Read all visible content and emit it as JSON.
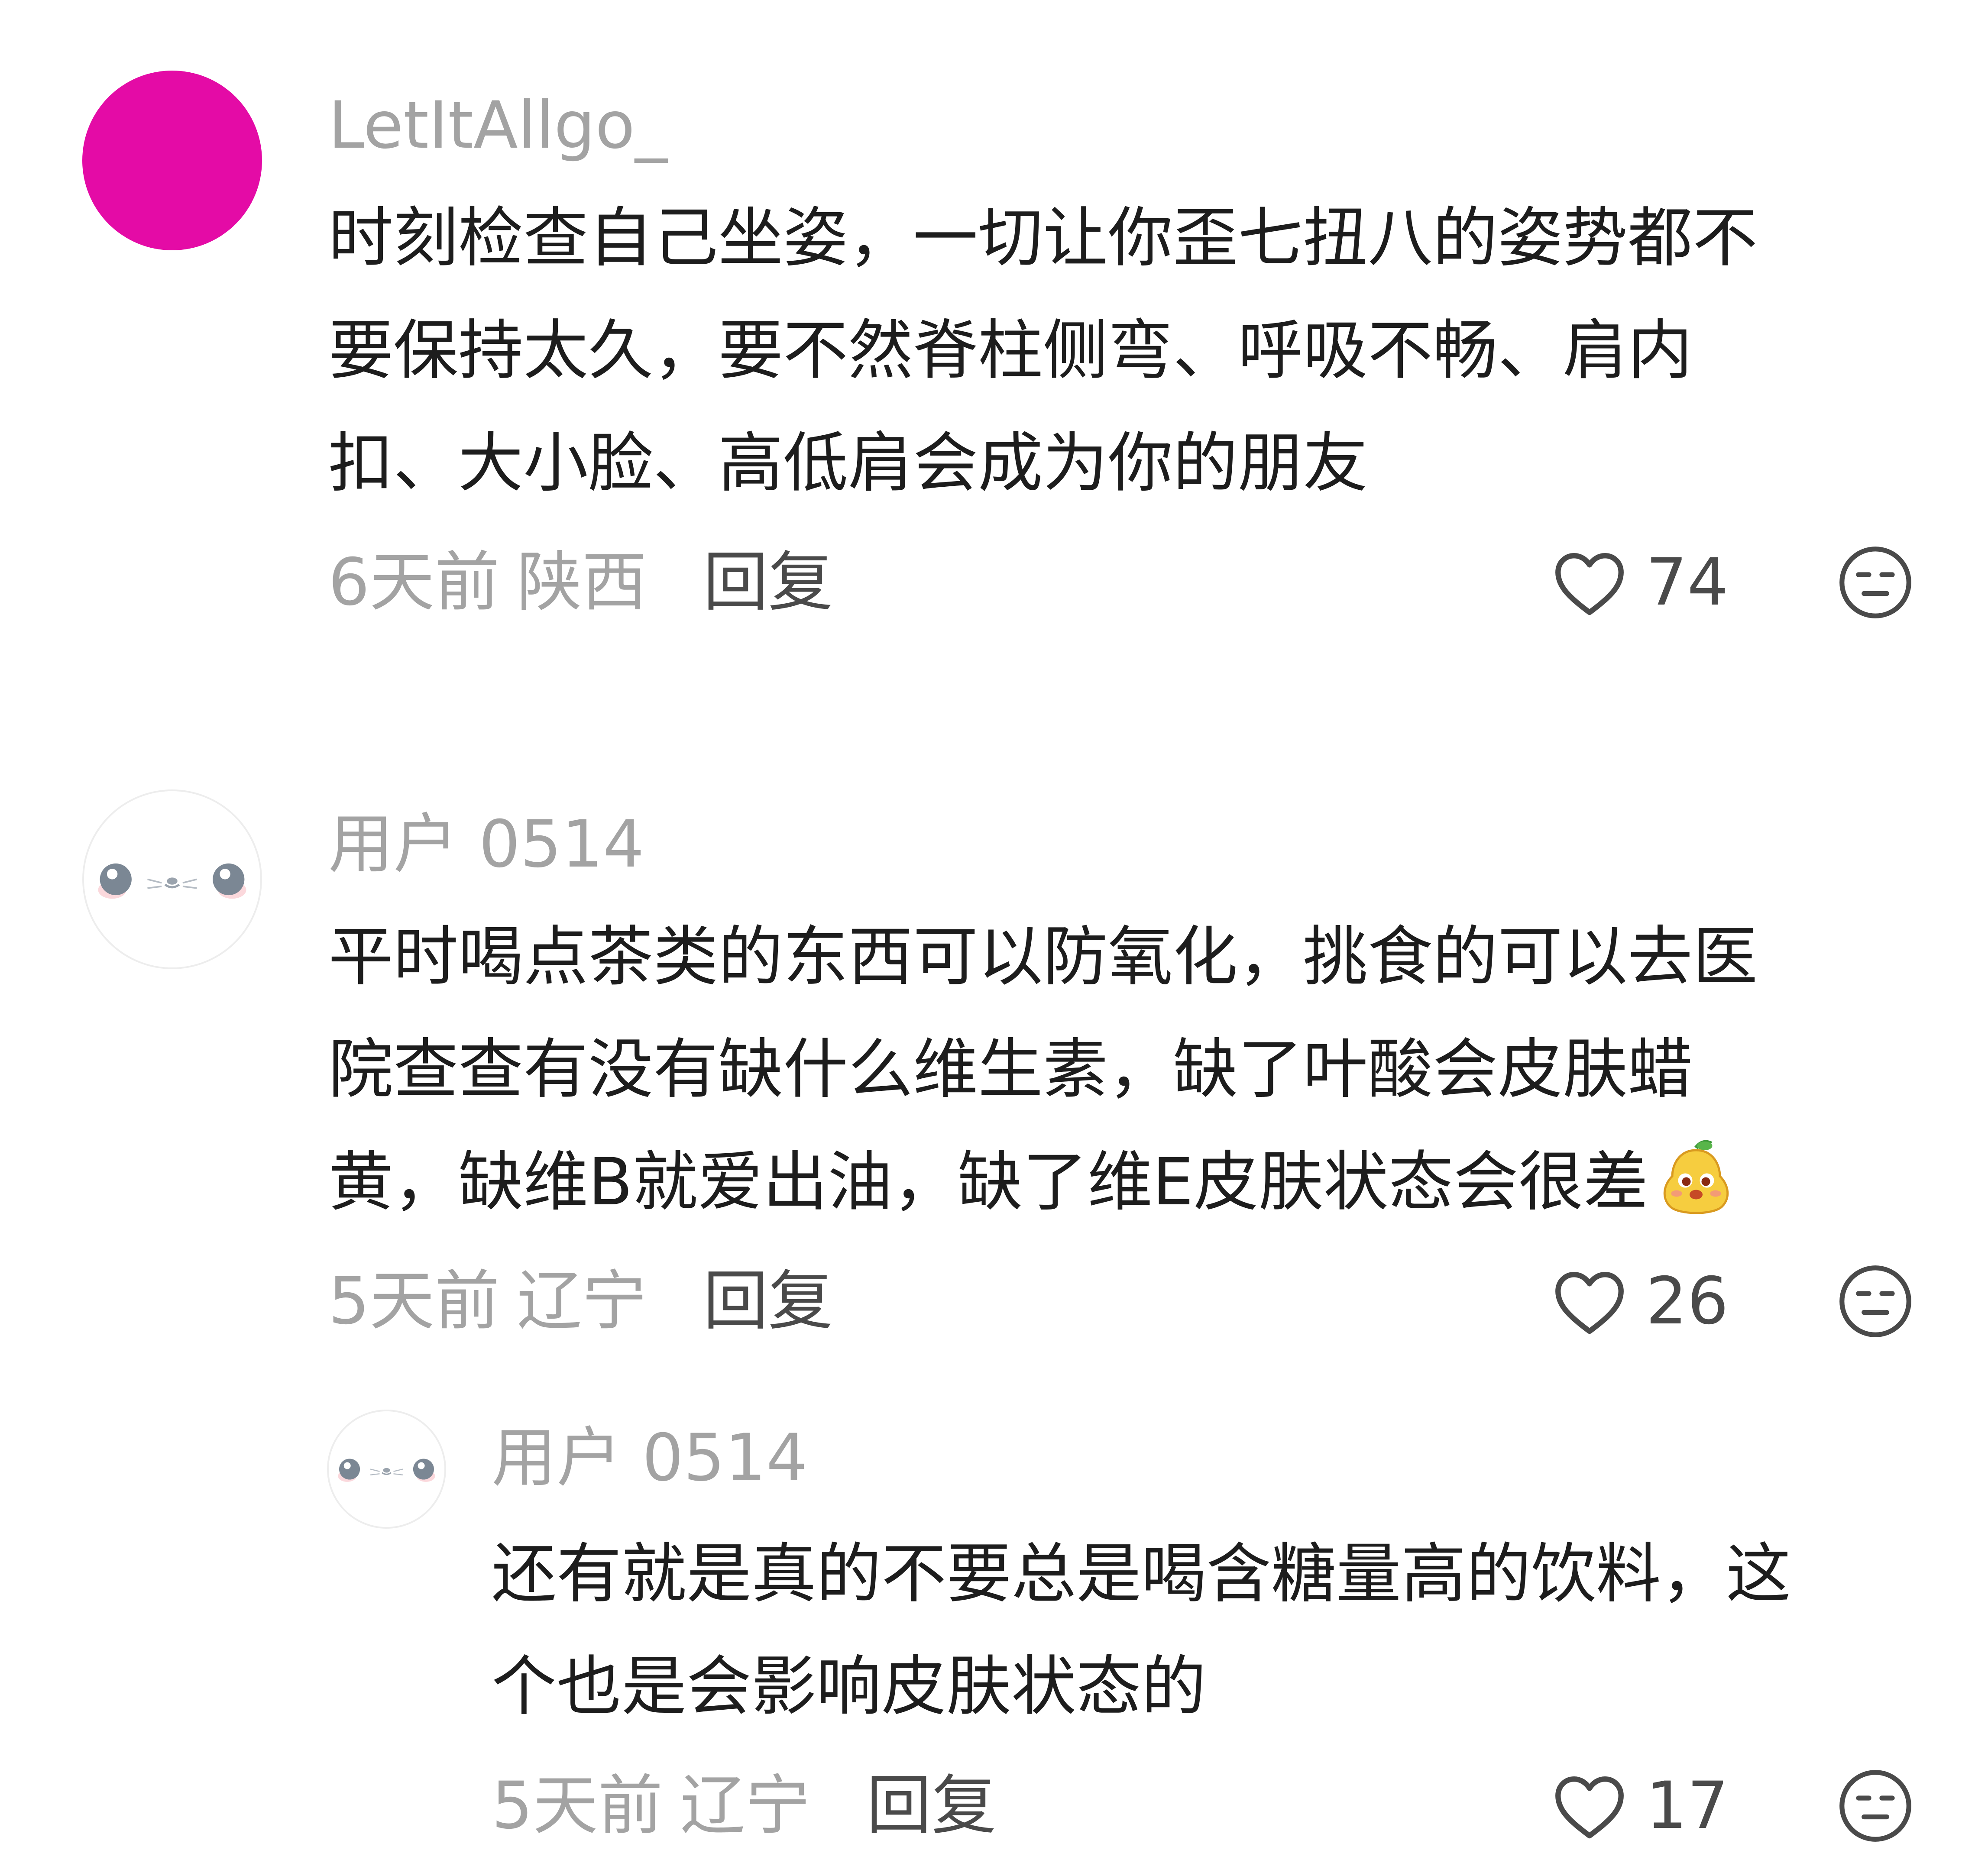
{
  "comments": [
    {
      "username": "LetItAllgo_",
      "avatar_color": "#e40ba6",
      "body_lines": [
        "时刻检查自己坐姿，一切让你歪七扭八的姿势都不",
        "要保持太久，要不然脊柱侧弯、呼吸不畅、肩内",
        "扣、大小脸、高低肩会成为你的朋友"
      ],
      "time": "6天前",
      "location": "陕西",
      "reply_label": "回复",
      "likes": "74"
    },
    {
      "username": "用户 0514",
      "body_lines": [
        "平时喝点茶类的东西可以防氧化，挑食的可以去医",
        "院查查有没有缺什么维生素，缺了叶酸会皮肤蜡",
        "黄，缺维B就爱出油，缺了维E皮肤状态会很差"
      ],
      "time": "5天前",
      "location": "辽宁",
      "reply_label": "回复",
      "likes": "26"
    },
    {
      "username": "用户 0514",
      "body_lines": [
        "还有就是真的不要总是喝含糖量高的饮料，这",
        "个也是会影响皮肤状态的"
      ],
      "time": "5天前",
      "location": "辽宁",
      "reply_label": "回复",
      "likes": "17"
    }
  ]
}
